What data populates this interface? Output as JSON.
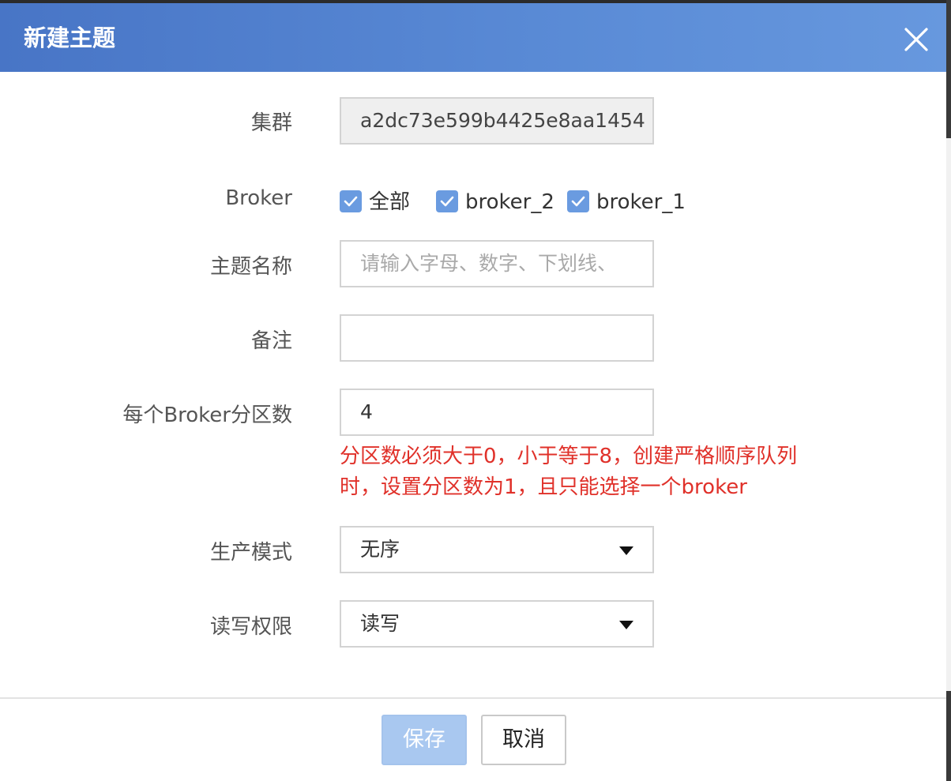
{
  "dialog": {
    "title": "新建主题",
    "close_icon": "close-icon"
  },
  "form": {
    "cluster": {
      "label": "集群",
      "value": "a2dc73e599b4425e8aa1454"
    },
    "broker": {
      "label": "Broker",
      "options": [
        {
          "label": "全部",
          "checked": true
        },
        {
          "label": "broker_2",
          "checked": true
        },
        {
          "label": "broker_1",
          "checked": true
        }
      ]
    },
    "topic_name": {
      "label": "主题名称",
      "value": "",
      "placeholder": "请输入字母、数字、下划线、"
    },
    "remark": {
      "label": "备注",
      "value": ""
    },
    "partitions": {
      "label": "每个Broker分区数",
      "value": "4",
      "hint_line1": "分区数必须大于0，小于等于8，创建严格顺序队列",
      "hint_line2": "时，设置分区数为1，且只能选择一个broker"
    },
    "produce_mode": {
      "label": "生产模式",
      "selected": "无序"
    },
    "permission": {
      "label": "读写权限",
      "selected": "读写"
    }
  },
  "footer": {
    "save_label": "保存",
    "cancel_label": "取消"
  },
  "colors": {
    "header_start": "#4875c6",
    "header_end": "#6798de",
    "checkbox": "#6a9be0",
    "error_text": "#e0312a",
    "save_button": "#a9c8f0"
  }
}
